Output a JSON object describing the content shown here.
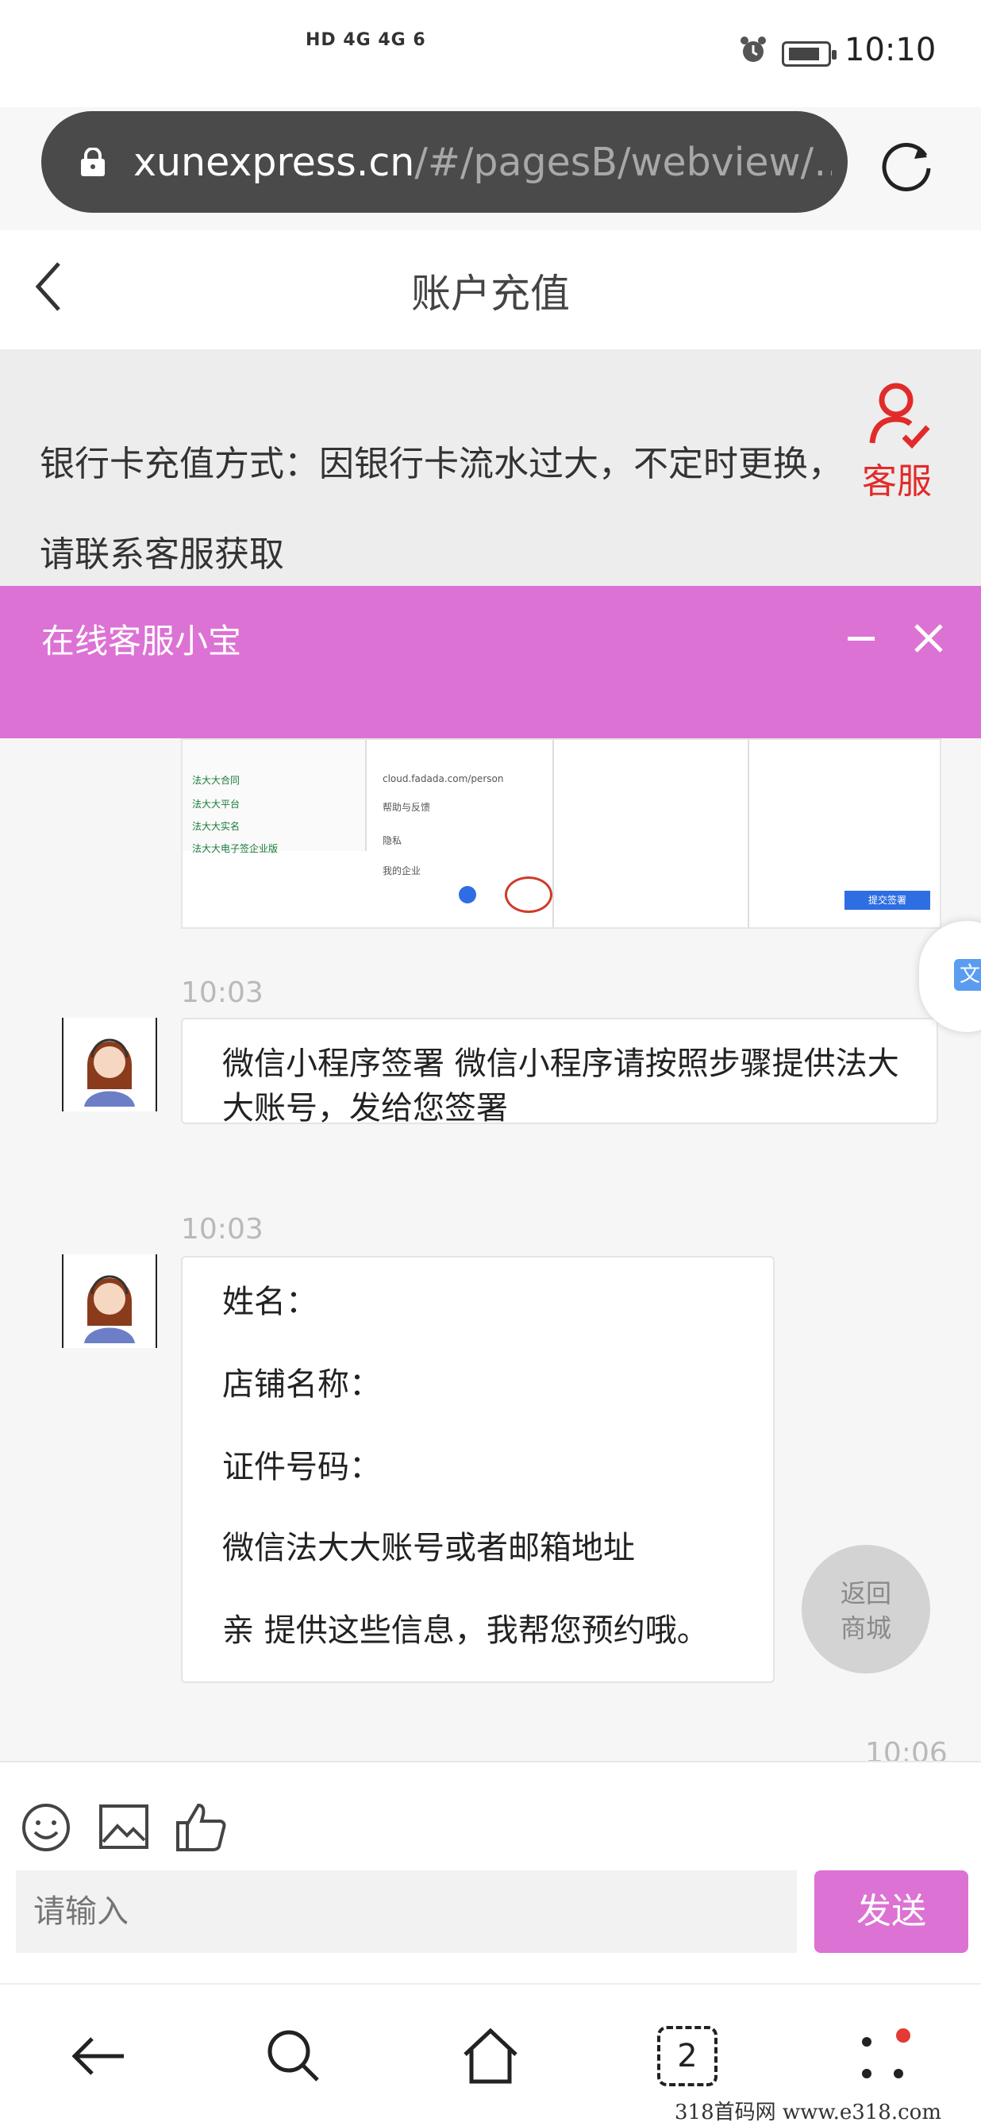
{
  "status": {
    "signal_text": "HD 4G 4G 6",
    "time": "10:10"
  },
  "browser": {
    "url_host": "xunexpress.cn",
    "url_path": "/#/pagesB/webview/…"
  },
  "header": {
    "title": "账户充值"
  },
  "notice": {
    "line1": "银行卡充值方式：因银行卡流水过大，不定时更换，",
    "line2": "请联系客服获取",
    "service_label": "客服"
  },
  "chat": {
    "title": "在线客服小宝",
    "messages": [
      {
        "time": "10:03",
        "text": "微信小程序签署 微信小程序请按照步骤提供法大大账号，发给您签署"
      },
      {
        "time": "10:03",
        "lines": [
          "姓名：",
          "店铺名称：",
          "证件号码：",
          "微信法大大账号或者邮箱地址",
          "亲 提供这些信息，我帮您预约哦。"
        ]
      }
    ],
    "partial_time": "10:06",
    "screenshot_rows": [
      "法大大合同",
      "法大大平台",
      "法大大实名",
      "法大大电子签企业版"
    ],
    "screenshot_menu": [
      "帮助与反馈",
      "隐私",
      "我的企业"
    ],
    "screenshot_url": "cloud.fadada.com/person",
    "screenshot_button": "提交签署"
  },
  "return_button": {
    "line1": "返回",
    "line2": "商城"
  },
  "translate_label": "文",
  "input": {
    "placeholder": "请输入",
    "send_label": "发送"
  },
  "nav": {
    "tab_count": "2"
  },
  "watermark": "318首码网  www.e318.com",
  "colors": {
    "accent": "#dc72d4",
    "service_red": "#e22a2a"
  }
}
